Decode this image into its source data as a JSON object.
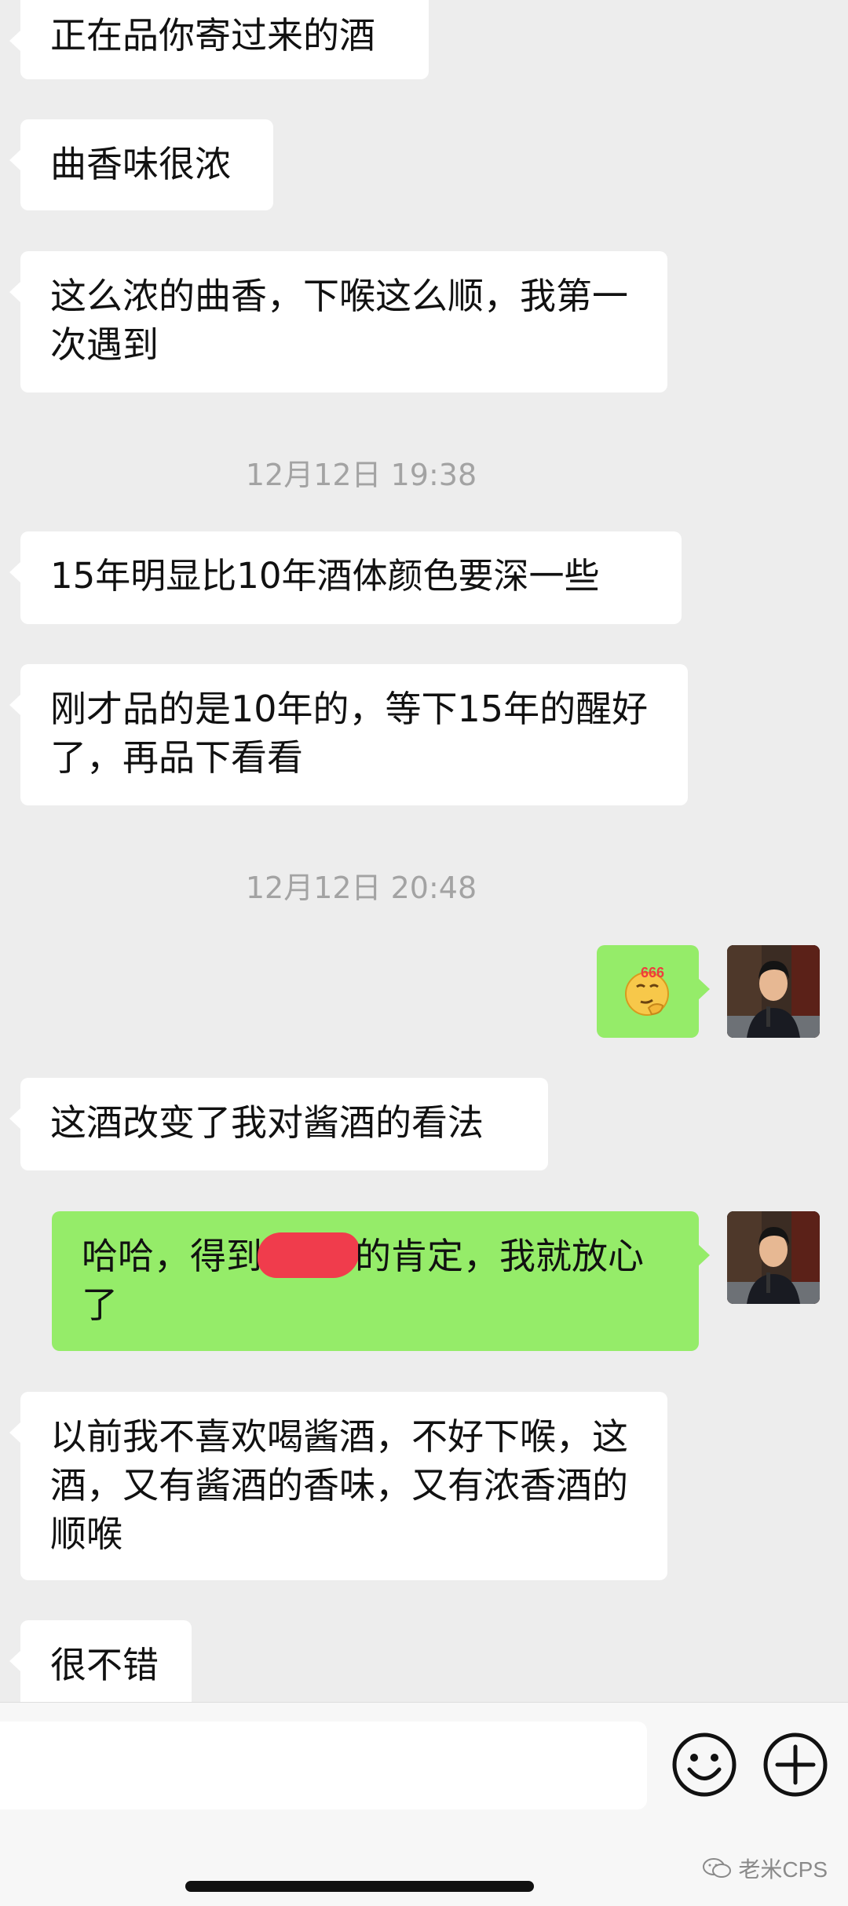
{
  "messages": [
    {
      "text": "正在品你寄过来的酒"
    },
    {
      "text": "曲香味很浓"
    },
    {
      "text": "这么浓的曲香，下喉这么顺，我第一次遇到"
    },
    {
      "text": "15年明显比10年酒体颜色要深一些"
    },
    {
      "text": "刚才品的是10年的，等下15年的醒好了，再品下看看"
    },
    {
      "emoji_label": "666"
    },
    {
      "text": "这酒改变了我对酱酒的看法"
    },
    {
      "text_before": "哈哈，得到",
      "text_after": "的肯定，我就放心了"
    },
    {
      "text": "以前我不喜欢喝酱酒，不好下喉，这酒，又有酱酒的香味，又有浓香酒的顺喉"
    },
    {
      "text": "很不错"
    }
  ],
  "timestamps": [
    "12月12日 19:38",
    "12月12日 20:48"
  ],
  "input_bar": {
    "emoji_icon": "smiley-face-icon",
    "plus_icon": "plus-circle-icon"
  },
  "watermark": {
    "text": "老米CPS"
  },
  "colors": {
    "chat_background": "#ededed",
    "incoming_bubble": "#ffffff",
    "outgoing_bubble": "#95ec69",
    "timestamp_text": "#a3a3a3"
  }
}
